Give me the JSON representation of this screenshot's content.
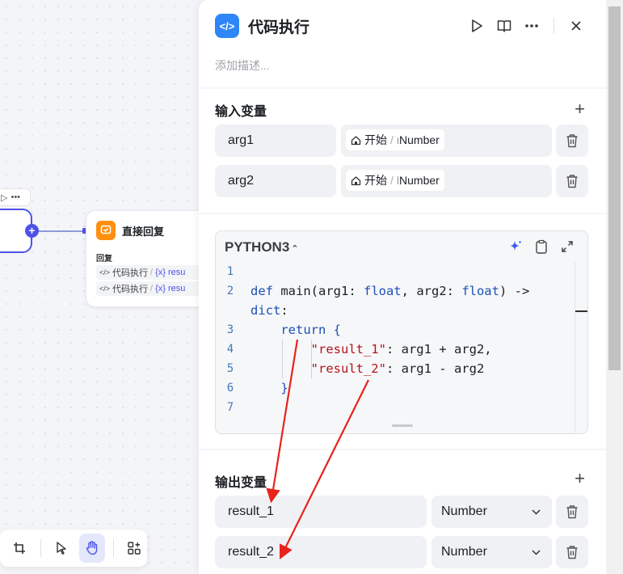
{
  "canvas": {
    "reply_node": {
      "title": "直接回复",
      "label": "回复",
      "rows": [
        {
          "source": "代码执行",
          "sep": "/",
          "var": "{x} resu"
        },
        {
          "source": "代码执行",
          "sep": "/",
          "var": "{x} resu"
        }
      ]
    },
    "left_node": {
      "port_symbol": "+"
    },
    "toolbar": {
      "items": [
        "add-node-icon",
        "pointer-icon",
        "hand-icon",
        "layout-icon"
      ],
      "active": "hand-icon"
    }
  },
  "panel": {
    "title": "代码执行",
    "badge_symbol": "</>",
    "description_placeholder": "添加描述...",
    "input_section": {
      "title": "输入变量",
      "add_symbol": "+",
      "rows": [
        {
          "name": "arg1",
          "ref_node": "开始",
          "ref_sep": "/",
          "ref_clip": "ι",
          "ref_type": "Number"
        },
        {
          "name": "arg2",
          "ref_node": "开始",
          "ref_sep": "/",
          "ref_clip": "l",
          "ref_type": "Number"
        }
      ]
    },
    "code": {
      "language": "PYTHON3",
      "language_chevron": "⌃⌄",
      "lines": [
        "1",
        "2",
        "",
        "3",
        "4",
        "5",
        "6",
        "7"
      ]
    },
    "output_section": {
      "title": "输出变量",
      "add_symbol": "+",
      "rows": [
        {
          "name": "result_1",
          "type": "Number"
        },
        {
          "name": "result_2",
          "type": "Number"
        }
      ]
    }
  },
  "colors": {
    "accent": "#4d53e8",
    "badge": "#2f86f6",
    "reply_icon": "#ff8f0f",
    "annotation_arrow": "#e8221b"
  }
}
